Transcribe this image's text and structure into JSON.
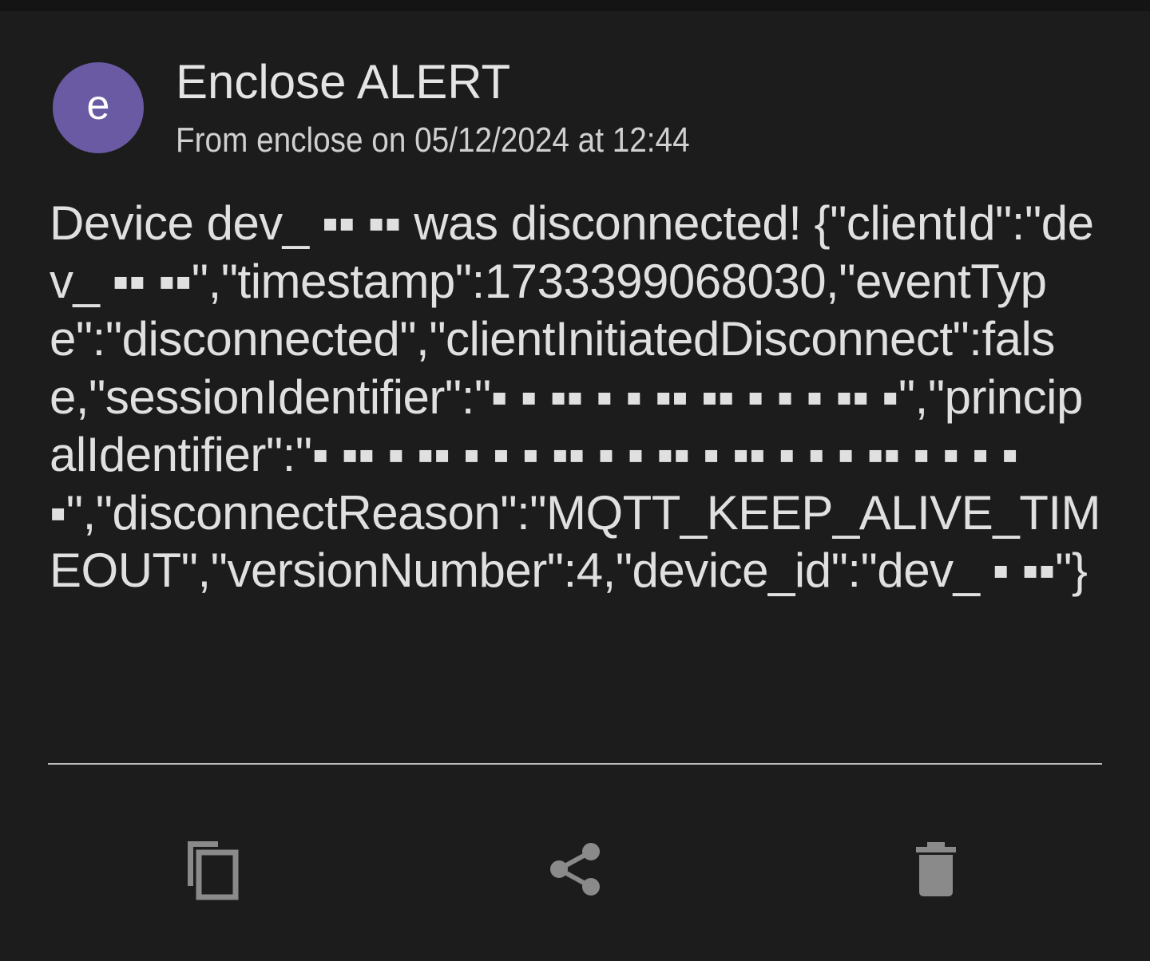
{
  "notification": {
    "avatar_letter": "e",
    "avatar_color": "#6a5aa3",
    "title": "Enclose ALERT",
    "subtitle": "From enclose on 05/12/2024 at 12:44",
    "message": "Device dev_ ▪▪ ▪▪ was disconnected! {\"clientId\":\"dev_ ▪▪ ▪▪\",\"timestamp\":1733399068030,\"eventType\":\"disconnected\",\"clientInitiatedDisconnect\":false,\"sessionIdentifier\":\"▪ ▪ ▪▪ ▪ ▪ ▪▪ ▪▪ ▪ ▪ ▪ ▪▪ ▪\",\"principalIdentifier\":\"▪ ▪▪ ▪ ▪▪ ▪ ▪ ▪ ▪▪ ▪ ▪ ▪▪ ▪ ▪▪ ▪ ▪ ▪ ▪▪ ▪ ▪ ▪ ▪ ▪\",\"disconnectReason\":\"MQTT_KEEP_ALIVE_TIMEOUT\",\"versionNumber\":4,\"device_id\":\"dev_ ▪ ▪▪\"}"
  },
  "actions": {
    "copy_icon": "copy-icon",
    "share_icon": "share-icon",
    "delete_icon": "delete-icon",
    "icon_color": "#8a8a8a"
  }
}
